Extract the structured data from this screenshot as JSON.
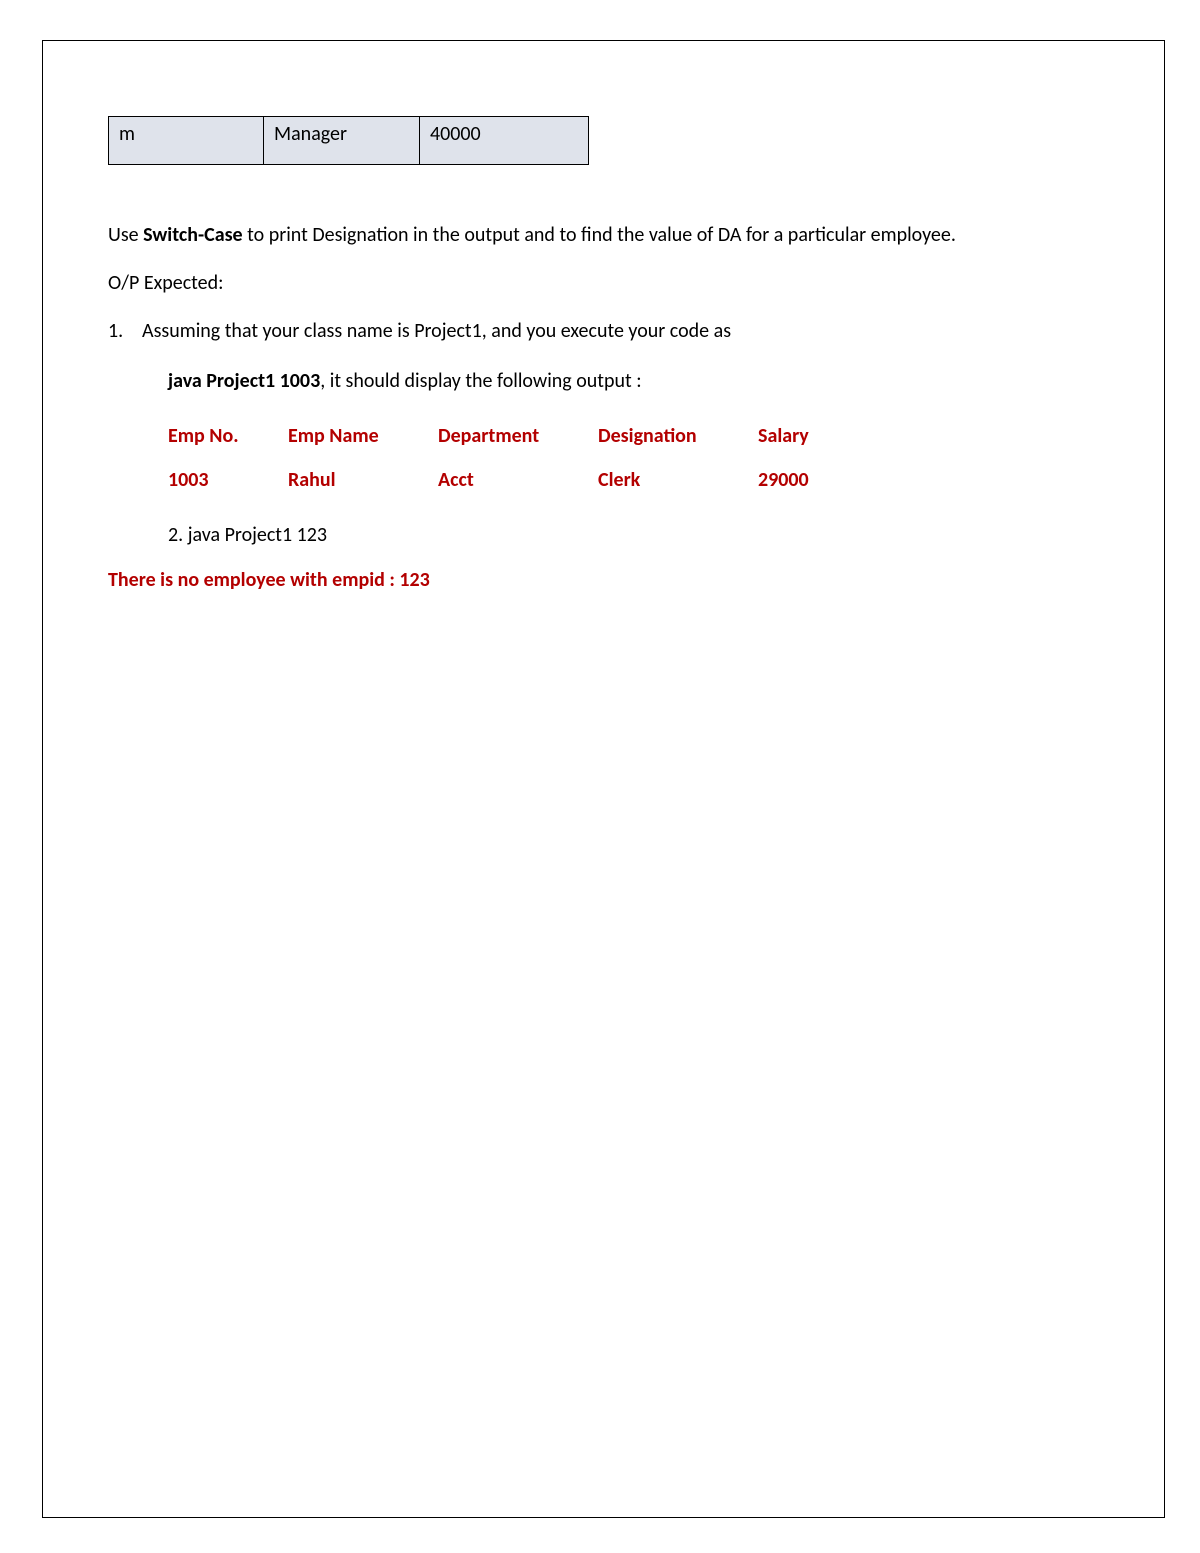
{
  "info_table": {
    "row": [
      "m",
      "Manager",
      "40000"
    ]
  },
  "para1_a": "Use ",
  "para1_b": "Switch-Case",
  "para1_c": " to print Designation in the output and to find the value of DA for a particular employee.",
  "op_expected": "O/P Expected:",
  "item1_num": "1.",
  "item1_text": "Assuming that your class name is Project1, and you execute your code as",
  "item1b_bold": "java Project1 1003",
  "item1b_rest": ", it should display the following output :",
  "out_header": [
    "Emp No.",
    "Emp Name",
    "Department",
    "Designation",
    "Salary"
  ],
  "out_row": [
    "1003",
    "Rahul",
    "Acct",
    "Clerk",
    "29000"
  ],
  "item2_text": "2. java Project1 123",
  "err_text": "There is no employee with empid : 123"
}
